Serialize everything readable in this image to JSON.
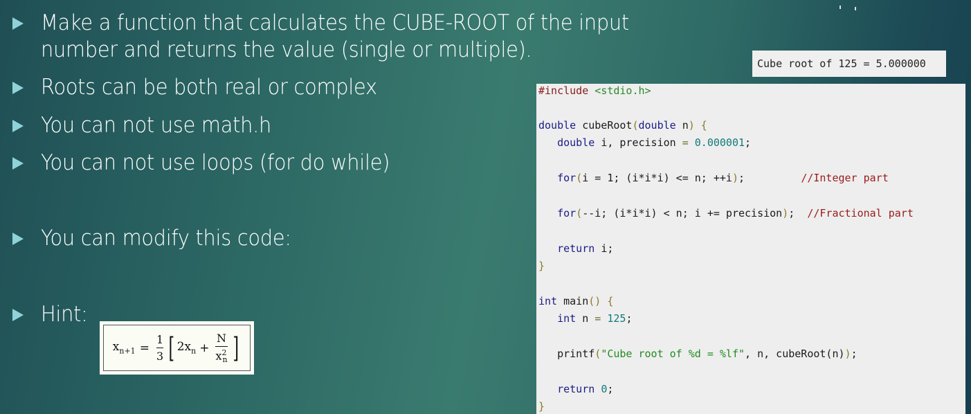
{
  "slide": {
    "bullets": [
      {
        "text": "Make a function that calculates the CUBE-ROOT of the input\nnumber and returns the value (single or multiple)."
      },
      {
        "text": "Roots can be both real or complex"
      },
      {
        "text": "You can not use math.h"
      },
      {
        "text": "You can not use loops (for do while)"
      },
      {
        "text": "You can modify this code:"
      },
      {
        "text": "Hint:"
      }
    ],
    "output": "Cube root of 125 = 5.000000",
    "code": {
      "include": "#include",
      "header": "<stdio.h>",
      "lines": {
        "fn_sig_type": "double",
        "fn_name": "cubeRoot",
        "fn_param_type": "double",
        "fn_param": "n",
        "decl_type": "double",
        "decl_vars": "i, precision",
        "precision_value": "0.000001",
        "for1_kw": "for",
        "for1_body": "i = 1; (i*i*i) <= n; ++i",
        "for1_comment": "//Integer part",
        "for2_kw": "for",
        "for2_body": "--i; (i*i*i) < n; i += precision",
        "for2_comment": "//Fractional part",
        "return1_kw": "return",
        "return1_val": "i",
        "main_type": "int",
        "main_name": "main",
        "n_type": "int",
        "n_name": "n",
        "n_value": "125",
        "printf_name": "printf",
        "printf_str": "\"Cube root of %d = %lf\"",
        "printf_args": "n, cubeRoot(n)",
        "return2_kw": "return",
        "return2_val": "0"
      }
    },
    "formula": {
      "lhs": "x",
      "lhs_sub": "n+1",
      "equals": "=",
      "frac_num": "1",
      "frac_den": "3",
      "term1": "2x",
      "term1_sub": "n",
      "plus": "+",
      "frac2_num": "N",
      "frac2_den": "x",
      "frac2_den_sub": "n",
      "frac2_den_sup": "2"
    }
  }
}
